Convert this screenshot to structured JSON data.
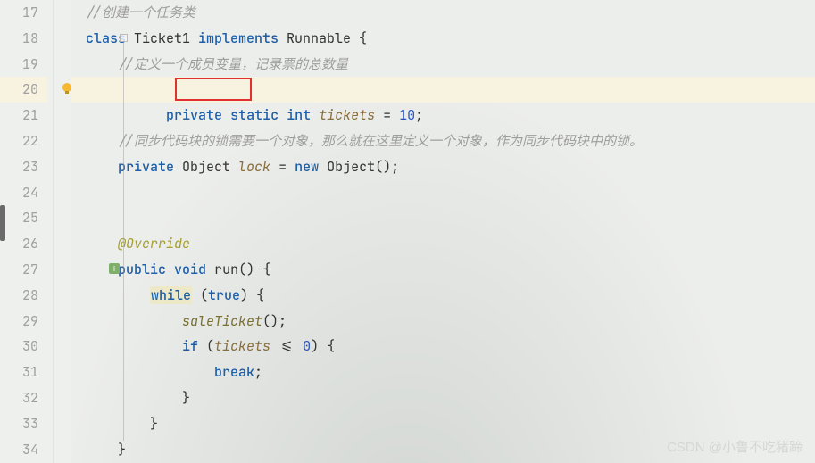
{
  "lines": {
    "17": {
      "num": "17"
    },
    "18": {
      "num": "18"
    },
    "19": {
      "num": "19"
    },
    "20": {
      "num": "20"
    },
    "21": {
      "num": "21"
    },
    "22": {
      "num": "22"
    },
    "23": {
      "num": "23"
    },
    "24": {
      "num": "24"
    },
    "25": {
      "num": "25"
    },
    "26": {
      "num": "26"
    },
    "27": {
      "num": "27"
    },
    "28": {
      "num": "28"
    },
    "29": {
      "num": "29"
    },
    "30": {
      "num": "30"
    },
    "31": {
      "num": "31"
    },
    "32": {
      "num": "32"
    },
    "33": {
      "num": "33"
    },
    "34": {
      "num": "34"
    }
  },
  "code": {
    "l17_comment": "//创建一个任务类",
    "l18_kw_class": "class",
    "l18_name": " Ticket1 ",
    "l18_kw_implements": "implements",
    "l18_rest": " Runnable {",
    "l19_comment": "//定义一个成员变量，记录票的总数量",
    "l20_kw_private": "private",
    "l20_kw_static": "static",
    "l20_kw_int": "int",
    "l20_var": "tickets",
    "l20_eq": " = ",
    "l20_num": "10",
    "l20_semi": ";",
    "l22_comment": "//同步代码块的锁需要一个对象，那么就在这里定义一个对象，作为同步代码块中的锁。",
    "l23_kw_private": "private",
    "l23_type": " Object ",
    "l23_var": "lock",
    "l23_eq": " = ",
    "l23_kw_new": "new",
    "l23_rest": " Object();",
    "l26_anno": "@Override",
    "l27_kw_public": "public",
    "l27_kw_void": "void",
    "l27_method": " run() {",
    "l28_kw_while": "while",
    "l28_cond": " (",
    "l28_kw_true": "true",
    "l28_rest": ") {",
    "l29_call": "saleTicket",
    "l29_rest": "();",
    "l30_kw_if": "if",
    "l30_open": " (",
    "l30_var": "tickets",
    "l30_op": " <= ",
    "l30_num": "0",
    "l30_rest": ") {",
    "l31_kw_break": "break",
    "l31_semi": ";",
    "l32_brace": "}",
    "l33_brace": "}",
    "l34_brace": "}"
  },
  "watermark": "CSDN @小鲁不吃猪蹄"
}
